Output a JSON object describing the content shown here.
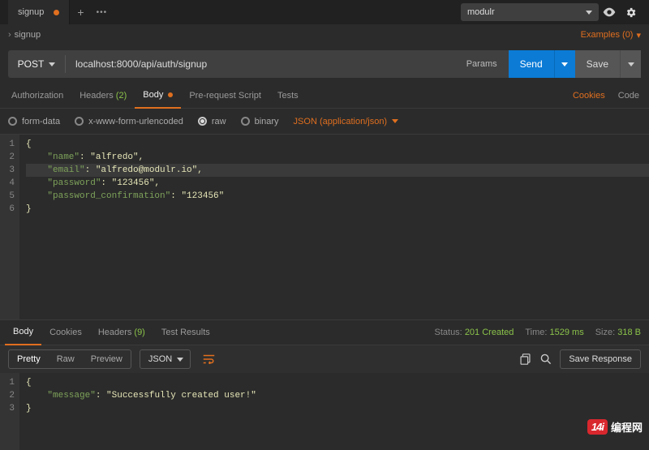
{
  "topbar": {
    "tab_title": "signup",
    "plus": "+",
    "dots": "•••",
    "environment": "modulr"
  },
  "breadcrumb": {
    "title": "signup",
    "examples_label": "Examples (0)"
  },
  "request": {
    "method": "POST",
    "url": "localhost:8000/api/auth/signup",
    "params_label": "Params",
    "send_label": "Send",
    "save_label": "Save"
  },
  "req_tabs": {
    "authorization": "Authorization",
    "headers": "Headers",
    "headers_count": "(2)",
    "body": "Body",
    "prerequest": "Pre-request Script",
    "tests": "Tests",
    "cookies": "Cookies",
    "code": "Code"
  },
  "body_type": {
    "formdata": "form-data",
    "urlencoded": "x-www-form-urlencoded",
    "raw": "raw",
    "binary": "binary",
    "content_type": "JSON (application/json)"
  },
  "request_body": {
    "line_numbers": [
      "1",
      "2",
      "3",
      "4",
      "5",
      "6"
    ],
    "k_name": "\"name\"",
    "v_name": "\"alfredo\"",
    "k_email": "\"email\"",
    "v_email": "\"alfredo@modulr.io\"",
    "k_password": "\"password\"",
    "v_password": "\"123456\"",
    "k_pc": "\"password_confirmation\"",
    "v_pc": "\"123456\""
  },
  "resp_tabs": {
    "body": "Body",
    "cookies": "Cookies",
    "headers": "Headers",
    "headers_count": "(9)",
    "test_results": "Test Results"
  },
  "resp_stats": {
    "status_label": "Status:",
    "status_value": "201 Created",
    "time_label": "Time:",
    "time_value": "1529 ms",
    "size_label": "Size:",
    "size_value": "318 B"
  },
  "resp_sub": {
    "pretty": "Pretty",
    "raw": "Raw",
    "preview": "Preview",
    "json": "JSON",
    "save_response": "Save Response"
  },
  "response_body": {
    "line_numbers": [
      "1",
      "2",
      "3"
    ],
    "k_message": "\"message\"",
    "v_message": "\"Successfully created user!\""
  },
  "watermark": {
    "logo": "14i",
    "text": "编程网"
  }
}
